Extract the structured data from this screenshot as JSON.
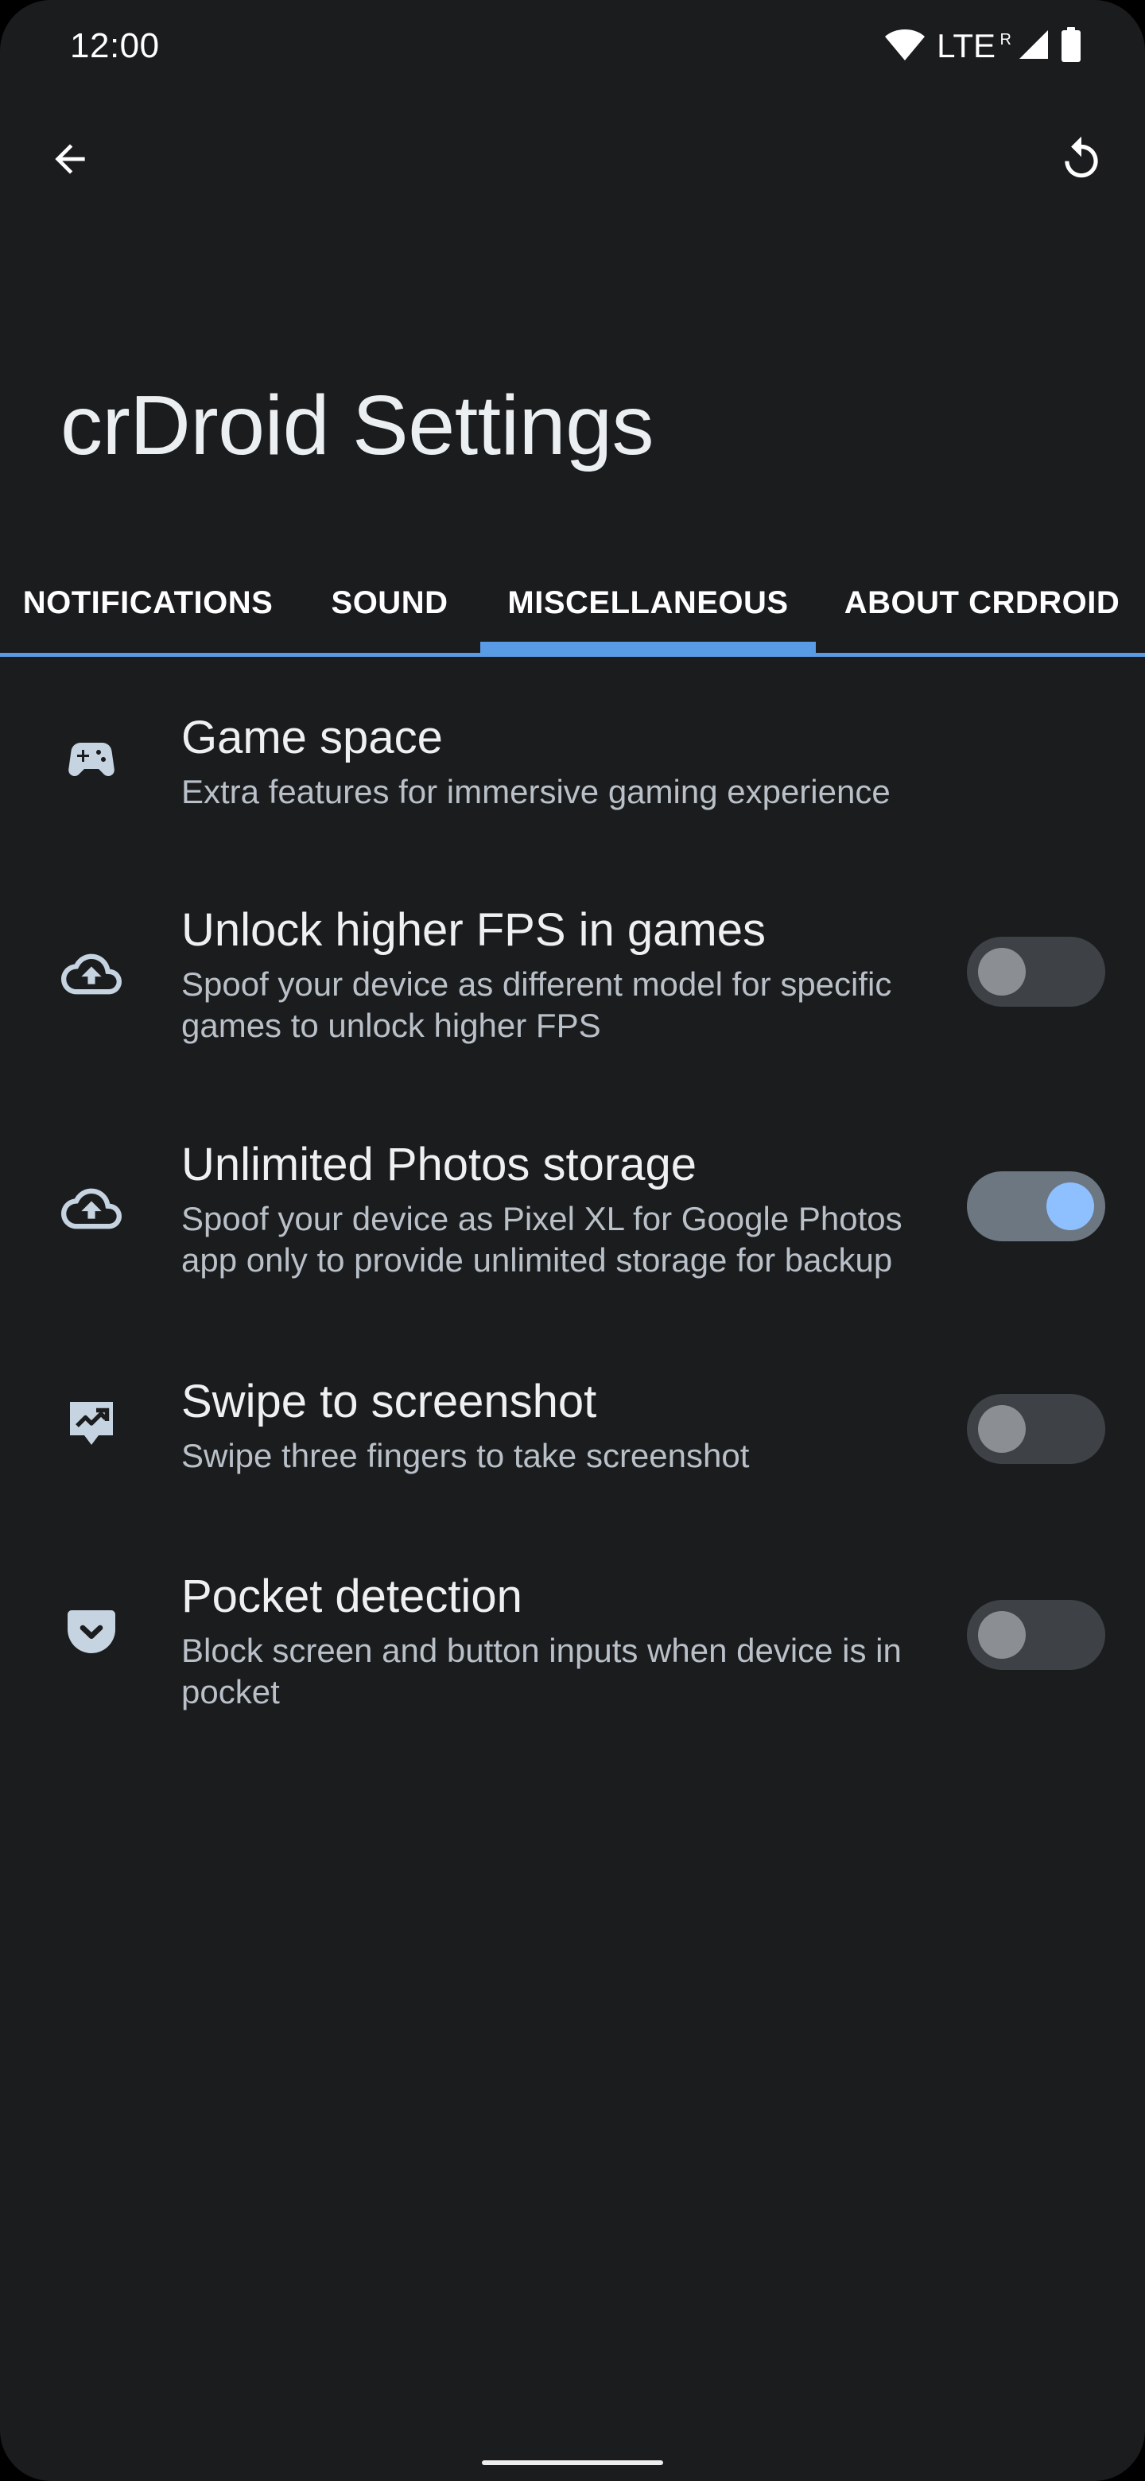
{
  "status_bar": {
    "time": "12:00",
    "network": "LTE",
    "roaming": "R",
    "icons": [
      "wifi-icon",
      "signal-icon",
      "battery-icon"
    ]
  },
  "toolbar": {
    "back_icon": "arrow-back-icon",
    "reset_icon": "restore-icon"
  },
  "page": {
    "title": "crDroid Settings"
  },
  "tabs": [
    {
      "label": "NOTIFICATIONS",
      "selected": false
    },
    {
      "label": "SOUND",
      "selected": false
    },
    {
      "label": "MISCELLANEOUS",
      "selected": true
    },
    {
      "label": "ABOUT CRDROID",
      "selected": false
    }
  ],
  "colors": {
    "background": "#1b1c1e",
    "accent": "#5a9be6",
    "switch_on_thumb": "#8ec0ff",
    "summary_text": "#b9c0c8"
  },
  "settings": [
    {
      "icon": "gamepad-icon",
      "title": "Game space",
      "summary": "Extra features for immersive gaming experience",
      "has_switch": false
    },
    {
      "icon": "cloud-upload-icon",
      "title": "Unlock higher FPS in games",
      "summary": "Spoof your device as different model for specific games to unlock higher FPS",
      "has_switch": true,
      "checked": false
    },
    {
      "icon": "cloud-upload-icon",
      "title": "Unlimited Photos storage",
      "summary": "Spoof your device as Pixel XL for Google Photos app only to provide unlimited storage for backup",
      "has_switch": true,
      "checked": true
    },
    {
      "icon": "screenshot-gesture-icon",
      "title": "Swipe to screenshot",
      "summary": "Swipe three fingers to take screenshot",
      "has_switch": true,
      "checked": false
    },
    {
      "icon": "pocket-icon",
      "title": "Pocket detection",
      "summary": "Block screen and button inputs when device is in pocket",
      "has_switch": true,
      "checked": false
    }
  ]
}
